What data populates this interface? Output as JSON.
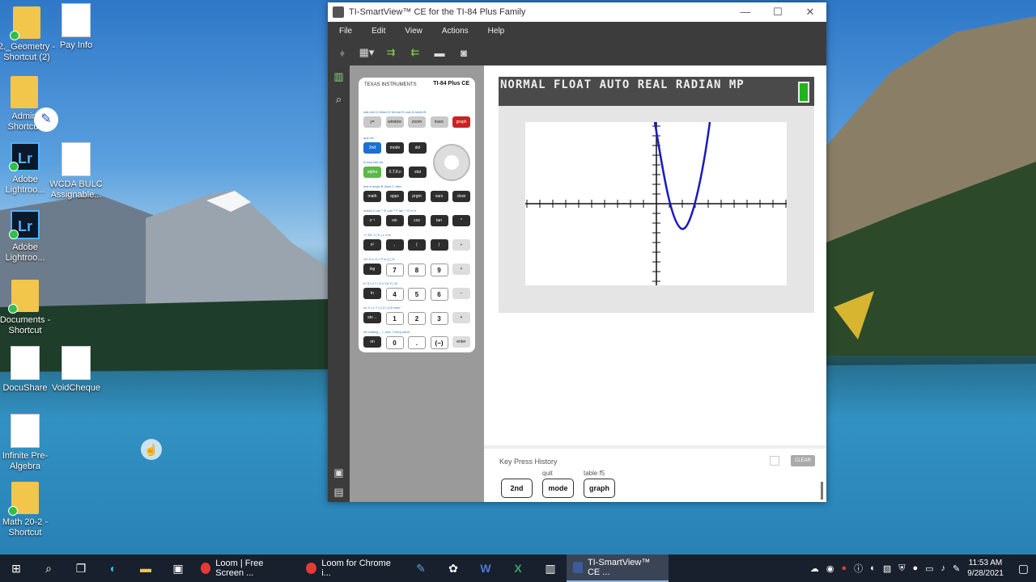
{
  "desktop_icons": [
    {
      "label": "2._Geometry - Shortcut (2)",
      "kind": "folder"
    },
    {
      "label": "Pay Info",
      "kind": "doc"
    },
    {
      "label": "Admin Shortcut",
      "kind": "folder"
    },
    {
      "label": "Adobe Lightroo...",
      "kind": "lr"
    },
    {
      "label": "WCDA BULC Assignable...",
      "kind": "doc"
    },
    {
      "label": "Adobe Lightroo...",
      "kind": "lr"
    },
    {
      "label": "Documents - Shortcut",
      "kind": "folder"
    },
    {
      "label": "DocuShare",
      "kind": "doc"
    },
    {
      "label": "VoidCheque",
      "kind": "doc"
    },
    {
      "label": "Infinite Pre-Algebra",
      "kind": "doc"
    },
    {
      "label": "Math 20-2 - Shortcut",
      "kind": "folder"
    }
  ],
  "window": {
    "title": "TI-SmartView™ CE for the TI-84 Plus Family",
    "menu": [
      "File",
      "Edit",
      "View",
      "Actions",
      "Help"
    ]
  },
  "calculator": {
    "brand": "TEXAS INSTRUMENTS",
    "model": "TI-84 Plus CE",
    "rows": [
      {
        "labels": "stat plot f1  tblset f2  format f3  calc f4  table f5",
        "keys": [
          [
            "y=",
            "g"
          ],
          [
            "window",
            "g"
          ],
          [
            "zoom",
            "g"
          ],
          [
            "trace",
            "g"
          ],
          [
            "graph",
            "r"
          ]
        ]
      },
      {
        "labels": "quit  ins",
        "keys": [
          [
            "2nd",
            "b"
          ],
          [
            "mode",
            ""
          ],
          [
            "del",
            ""
          ]
        ]
      },
      {
        "labels": "A-lock  link  list",
        "keys": [
          [
            "alpha",
            "a"
          ],
          [
            "X,T,θ,n",
            ""
          ],
          [
            "stat",
            ""
          ]
        ]
      },
      {
        "labels": "test A  angle B  draw C  distr",
        "keys": [
          [
            "math",
            ""
          ],
          [
            "apps",
            ""
          ],
          [
            "prgm",
            ""
          ],
          [
            "vars",
            ""
          ],
          [
            "clear",
            ""
          ]
        ]
      },
      {
        "labels": "matrix D  sin⁻¹ E  cos⁻¹ F  tan⁻¹ G  π H",
        "keys": [
          [
            "x⁻¹",
            ""
          ],
          [
            "sin",
            ""
          ],
          [
            "cos",
            ""
          ],
          [
            "tan",
            ""
          ],
          [
            "^",
            ""
          ]
        ]
      },
      {
        "labels": "√  I  EE J  { K  } L  e M",
        "keys": [
          [
            "x²",
            ""
          ],
          [
            ",",
            ""
          ],
          [
            "(",
            ""
          ],
          [
            ")",
            ""
          ],
          [
            "÷",
            "l"
          ]
        ]
      },
      {
        "labels": "10ˣ N  u O  v P  w Q  [ R",
        "keys": [
          [
            "log",
            ""
          ],
          [
            "7",
            "w"
          ],
          [
            "8",
            "w"
          ],
          [
            "9",
            "w"
          ],
          [
            "×",
            "l"
          ]
        ]
      },
      {
        "labels": "eˣ S  L4 T  L5 U  L6 V  ] W",
        "keys": [
          [
            "ln",
            ""
          ],
          [
            "4",
            "w"
          ],
          [
            "5",
            "w"
          ],
          [
            "6",
            "w"
          ],
          [
            "−",
            "l"
          ]
        ]
      },
      {
        "labels": "rcl X  L1 Y  L2 Z  L3 θ  mem \"",
        "keys": [
          [
            "sto→",
            ""
          ],
          [
            "1",
            "w"
          ],
          [
            "2",
            "w"
          ],
          [
            "3",
            "w"
          ],
          [
            "+",
            "l"
          ]
        ]
      },
      {
        "labels": "off  catalog _  i :  ans ?  entry solve",
        "keys": [
          [
            "on",
            ""
          ],
          [
            "0",
            "w"
          ],
          [
            ".",
            "w"
          ],
          [
            "(−)",
            "w"
          ],
          [
            "enter",
            "l"
          ]
        ]
      }
    ]
  },
  "screen": {
    "status": "NORMAL FLOAT AUTO REAL RADIAN MP",
    "battery_color": "#1eb51e"
  },
  "history": {
    "title": "Key Press History",
    "clear_label": "CLEAR",
    "keys": [
      {
        "label": "2nd",
        "sub": ""
      },
      {
        "label": "mode",
        "sub": "quit"
      },
      {
        "label": "graph",
        "sub": "table    f5"
      }
    ]
  },
  "taskbar": {
    "apps": [
      {
        "label": "Loom | Free Screen ...",
        "color": "#e53935",
        "active": false
      },
      {
        "label": "Loom for Chrome i...",
        "color": "#e53935",
        "active": false
      },
      {
        "label": "TI-SmartView™ CE ...",
        "color": "#3b5b99",
        "active": true
      }
    ],
    "time": "11:53 AM",
    "date": "9/28/2021"
  }
}
